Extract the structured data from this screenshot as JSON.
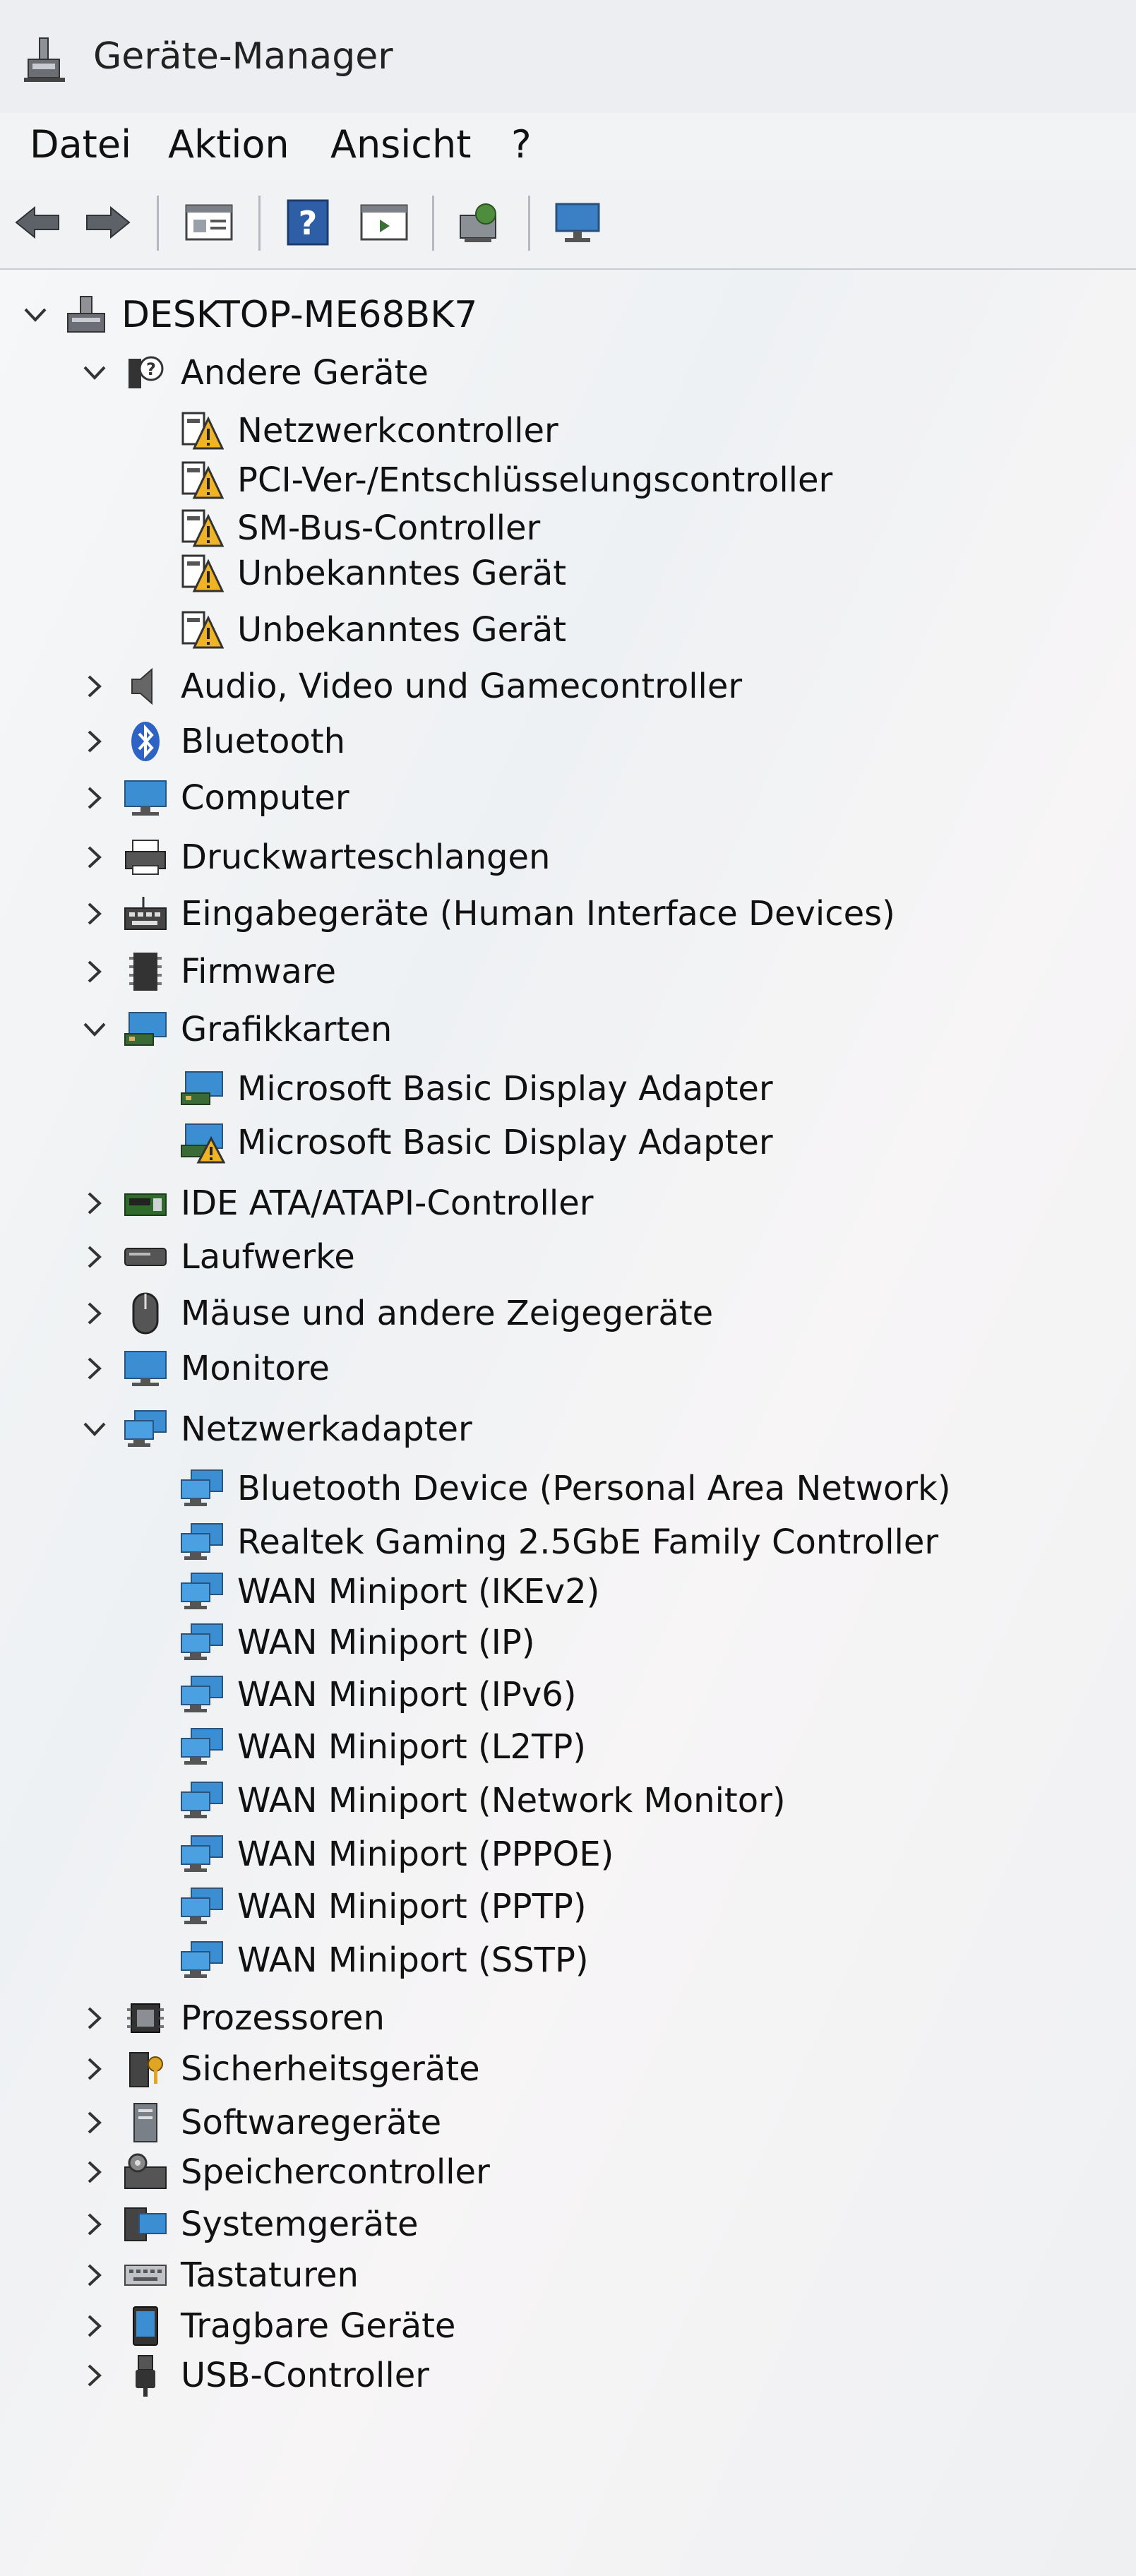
{
  "window": {
    "title": "Geräte-Manager",
    "app_icon": "device-manager-icon"
  },
  "menu": [
    {
      "label": "Datei"
    },
    {
      "label": "Aktion"
    },
    {
      "label": "Ansicht"
    },
    {
      "label": "?"
    }
  ],
  "toolbar": [
    {
      "name": "back-icon"
    },
    {
      "name": "forward-icon"
    },
    {
      "name": "properties-icon"
    },
    {
      "name": "help-icon"
    },
    {
      "name": "view-icon"
    },
    {
      "name": "scan-hardware-icon"
    },
    {
      "name": "monitor-icon"
    }
  ],
  "tree": {
    "root": {
      "label": "DESKTOP-ME68BK7",
      "icon": "computer-icon",
      "expanded": true
    },
    "nodes": [
      {
        "label": "Andere Geräte",
        "icon": "unknown-device-icon",
        "level": 1,
        "expanded": true
      },
      {
        "label": "Netzwerkcontroller",
        "icon": "warning-device-icon",
        "level": 2
      },
      {
        "label": "PCI-Ver-/Entschlüsselungscontroller",
        "icon": "warning-device-icon",
        "level": 2
      },
      {
        "label": "SM-Bus-Controller",
        "icon": "warning-device-icon",
        "level": 2
      },
      {
        "label": "Unbekanntes Gerät",
        "icon": "warning-device-icon",
        "level": 2
      },
      {
        "label": "Unbekanntes Gerät",
        "icon": "warning-device-icon",
        "level": 2
      },
      {
        "label": "Audio, Video und Gamecontroller",
        "icon": "speaker-icon",
        "level": 1,
        "expanded": false
      },
      {
        "label": "Bluetooth",
        "icon": "bluetooth-icon",
        "level": 1,
        "expanded": false
      },
      {
        "label": "Computer",
        "icon": "computer-icon",
        "level": 1,
        "expanded": false
      },
      {
        "label": "Druckwarteschlangen",
        "icon": "printer-icon",
        "level": 1,
        "expanded": false
      },
      {
        "label": "Eingabegeräte (Human Interface Devices)",
        "icon": "hid-icon",
        "level": 1,
        "expanded": false
      },
      {
        "label": "Firmware",
        "icon": "firmware-icon",
        "level": 1,
        "expanded": false
      },
      {
        "label": "Grafikkarten",
        "icon": "display-adapter-icon",
        "level": 1,
        "expanded": true
      },
      {
        "label": "Microsoft Basic Display Adapter",
        "icon": "display-adapter-icon",
        "level": 2
      },
      {
        "label": "Microsoft Basic Display Adapter",
        "icon": "display-adapter-warning-icon",
        "level": 2
      },
      {
        "label": "IDE ATA/ATAPI-Controller",
        "icon": "ide-controller-icon",
        "level": 1,
        "expanded": false
      },
      {
        "label": "Laufwerke",
        "icon": "disk-drive-icon",
        "level": 1,
        "expanded": false
      },
      {
        "label": "Mäuse und andere Zeigegeräte",
        "icon": "mouse-icon",
        "level": 1,
        "expanded": false
      },
      {
        "label": "Monitore",
        "icon": "monitor-icon",
        "level": 1,
        "expanded": false
      },
      {
        "label": "Netzwerkadapter",
        "icon": "network-adapter-icon",
        "level": 1,
        "expanded": true
      },
      {
        "label": "Bluetooth Device (Personal Area Network)",
        "icon": "network-adapter-icon",
        "level": 2
      },
      {
        "label": "Realtek Gaming 2.5GbE Family Controller",
        "icon": "network-adapter-icon",
        "level": 2
      },
      {
        "label": "WAN Miniport (IKEv2)",
        "icon": "network-adapter-icon",
        "level": 2
      },
      {
        "label": "WAN Miniport (IP)",
        "icon": "network-adapter-icon",
        "level": 2
      },
      {
        "label": "WAN Miniport (IPv6)",
        "icon": "network-adapter-icon",
        "level": 2
      },
      {
        "label": "WAN Miniport (L2TP)",
        "icon": "network-adapter-icon",
        "level": 2
      },
      {
        "label": "WAN Miniport (Network Monitor)",
        "icon": "network-adapter-icon",
        "level": 2
      },
      {
        "label": "WAN Miniport (PPPOE)",
        "icon": "network-adapter-icon",
        "level": 2
      },
      {
        "label": "WAN Miniport (PPTP)",
        "icon": "network-adapter-icon",
        "level": 2
      },
      {
        "label": "WAN Miniport (SSTP)",
        "icon": "network-adapter-icon",
        "level": 2
      },
      {
        "label": "Prozessoren",
        "icon": "processor-icon",
        "level": 1,
        "expanded": false
      },
      {
        "label": "Sicherheitsgeräte",
        "icon": "security-device-icon",
        "level": 1,
        "expanded": false
      },
      {
        "label": "Softwaregeräte",
        "icon": "software-device-icon",
        "level": 1,
        "expanded": false
      },
      {
        "label": "Speichercontroller",
        "icon": "storage-controller-icon",
        "level": 1,
        "expanded": false
      },
      {
        "label": "Systemgeräte",
        "icon": "system-device-icon",
        "level": 1,
        "expanded": false
      },
      {
        "label": "Tastaturen",
        "icon": "keyboard-icon",
        "level": 1,
        "expanded": false
      },
      {
        "label": "Tragbare Geräte",
        "icon": "portable-device-icon",
        "level": 1,
        "expanded": false
      },
      {
        "label": "USB-Controller",
        "icon": "usb-icon",
        "level": 1,
        "expanded": false
      }
    ]
  }
}
